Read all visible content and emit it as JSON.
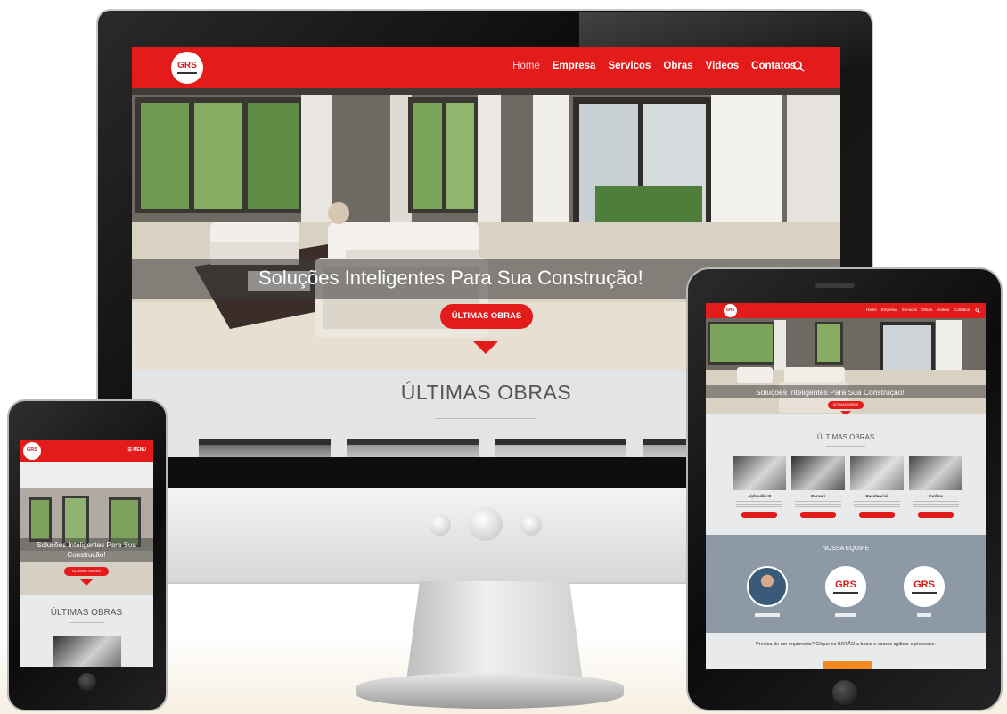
{
  "desktop": {
    "nav": {
      "logo_text": "GRS",
      "items": [
        {
          "label": "Home",
          "active": true
        },
        {
          "label": "Empresa",
          "active": false
        },
        {
          "label": "Servicos",
          "active": false
        },
        {
          "label": "Obras",
          "active": false
        },
        {
          "label": "Videos",
          "active": false
        },
        {
          "label": "Contatos",
          "active": false
        }
      ],
      "search_icon": "search-icon"
    },
    "hero": {
      "title": "Soluções Inteligentes Para Sua Construção!",
      "button_label": "ÚLTIMAS OBRAS"
    },
    "section_title": "ÚLTIMAS OBRAS"
  },
  "tablet": {
    "nav": {
      "logo_text": "GRS",
      "items": [
        "Home",
        "Empresa",
        "Servicos",
        "Obras",
        "Videos",
        "Contatos"
      ]
    },
    "hero": {
      "title": "Soluções Inteligentes Para Sua Construção!",
      "button_label": "ÚLTIMAS OBRAS"
    },
    "section_title": "ÚLTIMAS OBRAS",
    "cards": [
      {
        "name": "Alphaville III"
      },
      {
        "name": "Barueri"
      },
      {
        "name": "Residencial"
      },
      {
        "name": "Jardins"
      }
    ],
    "team_title": "NOSSA EQUIPE",
    "team_logo_text": "GRS",
    "cta_text": "Precisa de um orçamento? Clique no BOTÃO a baixo e vamos agilizar o processo."
  },
  "phone": {
    "logo_text": "GRS",
    "menu_label": "MENU",
    "hero": {
      "title": "Soluções Inteligentes Para Sua Construção!",
      "button_label": "ÚLTIMAS OBRAS"
    },
    "section_title": "ÚLTIMAS OBRAS"
  },
  "colors": {
    "brand_red": "#e31b1b",
    "cta_orange": "#f28a1f",
    "team_bg": "#8d9aa6"
  }
}
